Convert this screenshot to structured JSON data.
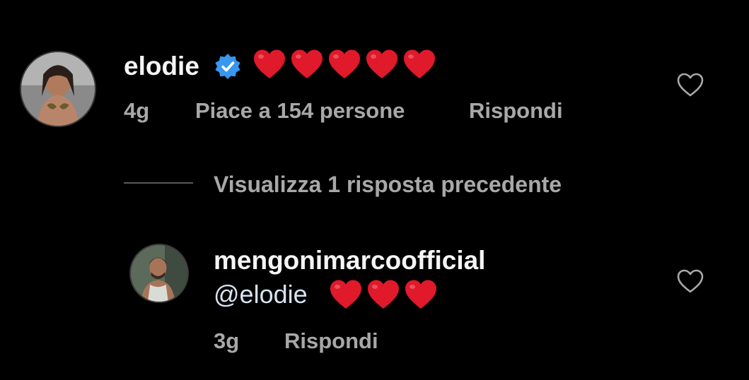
{
  "comment": {
    "username": "elodie",
    "verified": true,
    "text_emoji": "❤️❤️❤️❤️❤️",
    "heart_count": 5,
    "age": "4g",
    "likes": "Piace a 154 persone",
    "reply_label": "Rispondi"
  },
  "replies_toggle": {
    "label": "Visualizza 1 risposta precedente"
  },
  "reply": {
    "username": "mengonimarcoofficial",
    "mention": "@elodie",
    "text_emoji": "❤️❤️❤️",
    "heart_count": 3,
    "age": "3g",
    "reply_label": "Rispondi"
  },
  "colors": {
    "background": "#000000",
    "primary_text": "#f5f5f5",
    "secondary_text": "#a8a8a8",
    "verified_badge": "#3897f0",
    "heart": "#e0192b",
    "mention": "#d7e3f3"
  },
  "icons": {
    "verified": "verified-badge-icon",
    "like": "heart-outline-icon",
    "emoji": "red-heart-emoji"
  }
}
